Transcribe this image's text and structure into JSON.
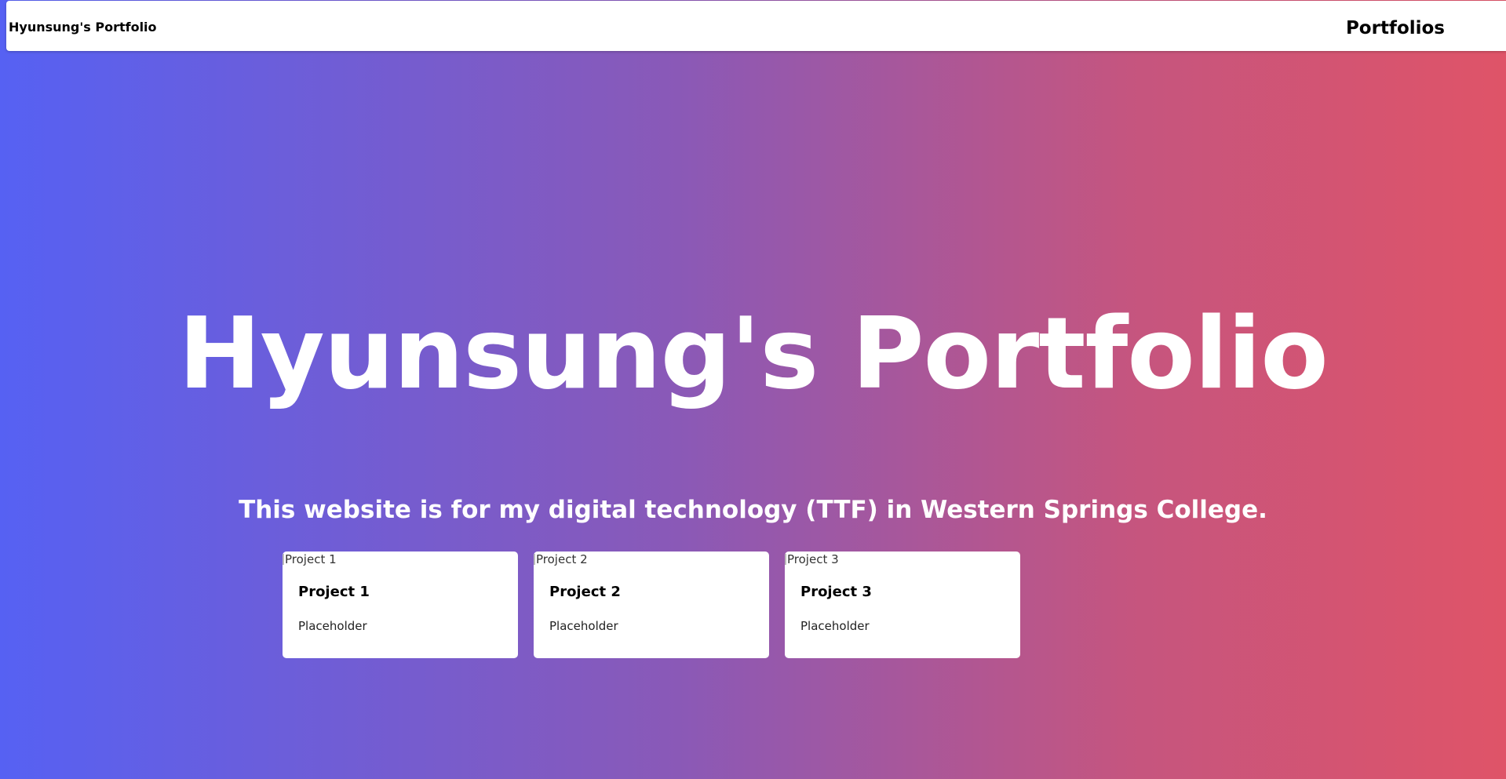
{
  "navbar": {
    "brand": "Hyunsung's Portfolio",
    "link": "Portfolios"
  },
  "hero": {
    "title": "Hyunsung's Portfolio",
    "subtitle": "This website is for my digital technology (TTF) in Western Springs College."
  },
  "cards": [
    {
      "image_alt": "Project 1",
      "title": "Project 1",
      "text": "Placeholder"
    },
    {
      "image_alt": "Project 2",
      "title": "Project 2",
      "text": "Placeholder"
    },
    {
      "image_alt": "Project 3",
      "title": "Project 3",
      "text": "Placeholder"
    }
  ],
  "colors": {
    "gradient_start": "#5661f3",
    "gradient_end": "#df5468",
    "card_bg": "#ffffff",
    "text_light": "#ffffff"
  }
}
